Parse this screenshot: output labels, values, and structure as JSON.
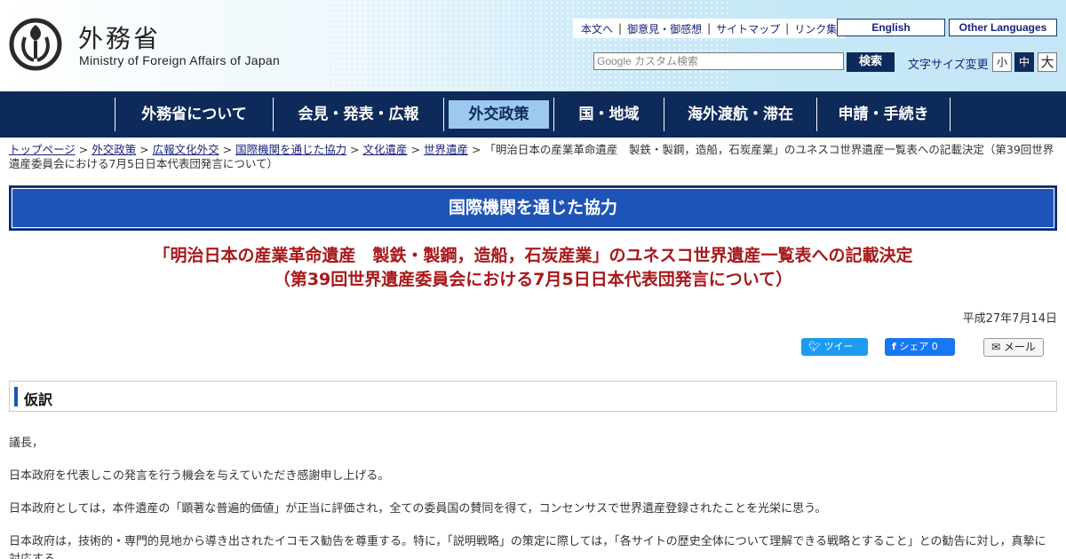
{
  "header": {
    "logo_ja": "外務省",
    "logo_en": "Ministry of Foreign Affairs of Japan",
    "top_links": [
      "本文へ",
      "御意見・御感想",
      "サイトマップ",
      "リンク集"
    ],
    "english_label": "English",
    "other_languages_label": "Other Languages",
    "search_placeholder": "Google カスタム検索",
    "search_button": "検索",
    "font_size_label": "文字サイズ変更",
    "font_size_options": [
      "小",
      "中",
      "大"
    ],
    "font_size_selected": "中"
  },
  "nav": {
    "items": [
      "外務省について",
      "会見・発表・広報",
      "外交政策",
      "国・地域",
      "海外渡航・滞在",
      "申請・手続き"
    ],
    "active": "外交政策"
  },
  "breadcrumb": {
    "links": [
      "トップページ",
      "外交政策",
      "広報文化外交",
      "国際機関を通じた協力",
      "文化遺産",
      "世界遺産"
    ],
    "current": "「明治日本の産業革命遺産　製鉄・製鋼，造船，石炭産業」のユネスコ世界遺産一覧表への記載決定（第39回世界遺産委員会における7月5日日本代表団発言について）"
  },
  "section_title": "国際機関を通じた協力",
  "article": {
    "title_line1": "「明治日本の産業革命遺産　製鉄・製鋼，造船，石炭産業」のユネスコ世界遺産一覧表への記載決定",
    "title_line2": "（第39回世界遺産委員会における7月5日日本代表団発言について）",
    "date": "平成27年7月14日",
    "share": {
      "tweet": "ツイート",
      "facebook": "シェア 0",
      "mail": "メール"
    },
    "tentative_heading": "仮訳",
    "paragraphs": [
      "議長，",
      "日本政府を代表しこの発言を行う機会を与えていただき感謝申し上げる。",
      "日本政府としては，本件遺産の「顕著な普遍的価値」が正当に評価され，全ての委員国の賛同を得て，コンセンサスで世界遺産登録されたことを光栄に思う。",
      "日本政府は，技術的・専門的見地から導き出されたイコモス勧告を尊重する。特に，「説明戦略」の策定に際しては，「各サイトの歴史全体について理解できる戦略とすること」との勧告に対し，真摯に対応する。"
    ]
  }
}
